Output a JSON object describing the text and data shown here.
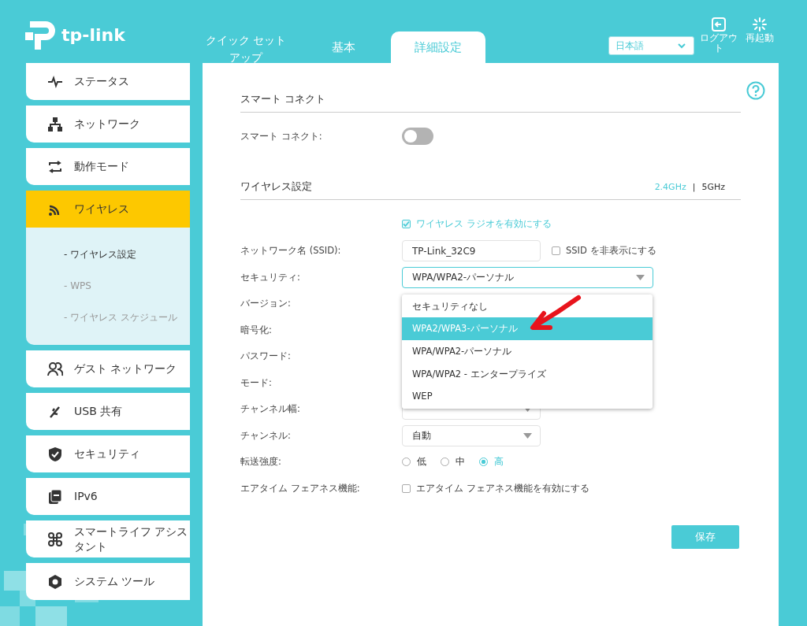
{
  "header": {
    "logo": "tp-link",
    "tabs": [
      {
        "label": "クイック セットアップ",
        "selected": false
      },
      {
        "label": "基本",
        "selected": false
      },
      {
        "label": "詳細設定",
        "selected": true
      }
    ],
    "language": {
      "value": "日本語"
    },
    "actions": [
      {
        "label": "ログアウト"
      },
      {
        "label": "再起動"
      }
    ]
  },
  "sidebar": {
    "items": [
      {
        "label": "ステータス",
        "selected": false
      },
      {
        "label": "ネットワーク",
        "selected": false
      },
      {
        "label": "動作モード",
        "selected": false
      },
      {
        "label": "ワイヤレス",
        "selected": true,
        "expanded": true,
        "children": [
          {
            "label": "- ワイヤレス設定",
            "selected": true
          },
          {
            "label": "- WPS",
            "selected": false
          },
          {
            "label": "- ワイヤレス スケジュール",
            "selected": false
          }
        ]
      },
      {
        "label": "ゲスト ネットワーク",
        "selected": false
      },
      {
        "label": "USB 共有",
        "selected": false
      },
      {
        "label": "セキュリティ",
        "selected": false
      },
      {
        "label": "IPv6",
        "selected": false
      },
      {
        "label": "スマートライフ アシスタント",
        "selected": false
      },
      {
        "label": "システム ツール",
        "selected": false
      }
    ]
  },
  "smart_connect": {
    "title": "スマート コネクト",
    "label": "スマート コネクト:",
    "on": false
  },
  "wireless": {
    "title": "ワイヤレス設定",
    "bands": [
      {
        "label": "2.4GHz",
        "selected": true
      },
      {
        "label": "5GHz",
        "selected": false
      }
    ],
    "band_separator": "|",
    "radio_enabled": {
      "label": "ワイヤレス ラジオを有効にする",
      "checked": true
    },
    "fields": [
      {
        "kind": "text",
        "label": "ネットワーク名 (SSID):",
        "value": "TP-Link_32C9",
        "option": {
          "label": "SSID を非表示にする",
          "checked": false
        }
      },
      {
        "kind": "select",
        "label": "セキュリティ:",
        "value": "WPA/WPA2-パーソナル",
        "wide": true,
        "open": true
      },
      {
        "kind": "label",
        "label": "バージョン:"
      },
      {
        "kind": "label",
        "label": "暗号化:"
      },
      {
        "kind": "label",
        "label": "パスワード:"
      },
      {
        "kind": "label",
        "label": "モード:"
      },
      {
        "kind": "select",
        "label": "チャンネル幅:",
        "wide": false,
        "open": false
      },
      {
        "kind": "select",
        "label": "チャンネル:",
        "value": "自動",
        "wide": false,
        "open": false
      },
      {
        "kind": "radio",
        "label": "転送強度:",
        "options": [
          {
            "label": "低",
            "selected": false
          },
          {
            "label": "中",
            "selected": false
          },
          {
            "label": "高",
            "selected": true
          }
        ]
      },
      {
        "kind": "checkbox",
        "label": "エアタイム フェアネス機能:",
        "option": {
          "label": "エアタイム フェアネス機能を有効にする",
          "checked": false
        }
      }
    ],
    "dropdown": {
      "options": [
        {
          "label": "セキュリティなし",
          "selected": false
        },
        {
          "label": "WPA2/WPA3-パーソナル",
          "selected": true
        },
        {
          "label": "WPA/WPA2-パーソナル",
          "selected": false
        },
        {
          "label": "WPA/WPA2 - エンタープライズ",
          "selected": false
        },
        {
          "label": "WEP",
          "selected": false
        }
      ]
    }
  },
  "save_button": "保存"
}
